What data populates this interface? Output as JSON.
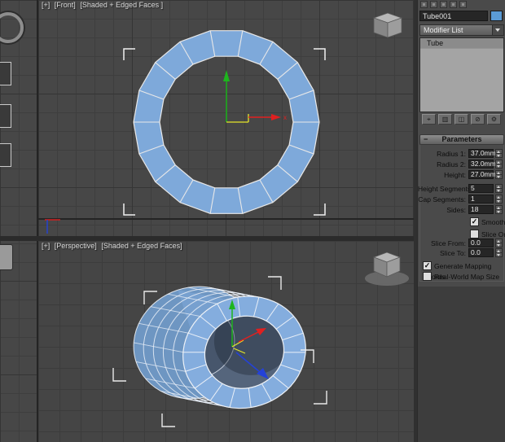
{
  "viewports": {
    "front": {
      "menu_plus": "[+]",
      "menu_name": "[Front]",
      "menu_shading": "[Shaded + Edged Faces ]",
      "x_axis_label": "x"
    },
    "perspective": {
      "menu_plus": "[+]",
      "menu_name": "[Perspective]",
      "menu_shading": "[Shaded + Edged Faces]"
    }
  },
  "panel": {
    "object_name": "Tube001",
    "object_color": "#5b9bd5",
    "modifier_list_label": "Modifier List",
    "modifier_stack": {
      "items": [
        {
          "label": "Tube"
        }
      ]
    },
    "stack_buttons": [
      {
        "name": "pin-stack",
        "glyph": "⌖"
      },
      {
        "name": "show-end-result",
        "glyph": "▥"
      },
      {
        "name": "make-unique",
        "glyph": "◫"
      },
      {
        "name": "remove-modifier",
        "glyph": "⊘"
      },
      {
        "name": "configure-modifier-sets",
        "glyph": "⚙"
      }
    ],
    "rollout_title": "Parameters",
    "rollout_collapse_glyph": "−",
    "parameters": {
      "radius1": {
        "label": "Radius 1:",
        "value": "37.0mm"
      },
      "radius2": {
        "label": "Radius 2:",
        "value": "32.0mm"
      },
      "height": {
        "label": "Height:",
        "value": "27.0mm"
      },
      "height_segments": {
        "label": "Height Segments:",
        "value": "5"
      },
      "cap_segments": {
        "label": "Cap Segments:",
        "value": "1"
      },
      "sides": {
        "label": "Sides:",
        "value": "18"
      },
      "smooth": {
        "label": "Smooth",
        "check": "✓"
      },
      "slice_on": {
        "label": "Slice On",
        "check": ""
      },
      "slice_from": {
        "label": "Slice From:",
        "value": "0.0"
      },
      "slice_to": {
        "label": "Slice To:",
        "value": "0.0"
      },
      "generate_mapping": {
        "label": "Generate Mapping Coords.",
        "check": "✓"
      },
      "real_world": {
        "label": "Real-World Map Size",
        "check": ""
      }
    }
  },
  "colors": {
    "ring_fill": "#7ea9da",
    "tube_front": "#84adde",
    "tube_back": "#6e96c2",
    "tube_band": "#77a0cf",
    "wire": "#e9eff7"
  }
}
